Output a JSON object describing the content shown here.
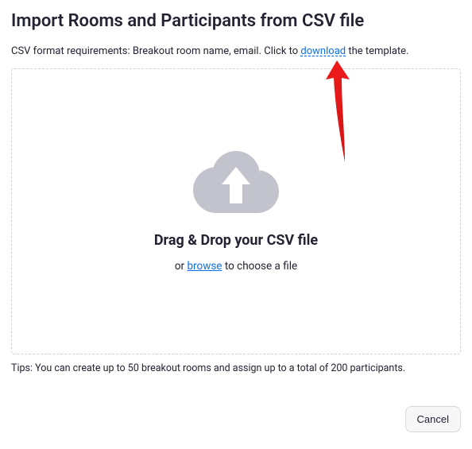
{
  "dialog": {
    "title": "Import Rooms and Participants from CSV file",
    "instructions_prefix": "CSV format requirements: Breakout room name, email. Click to ",
    "download_label": "download",
    "instructions_suffix": " the template.",
    "drop_title": "Drag & Drop your CSV file",
    "drop_sub_prefix": "or ",
    "browse_label": "browse",
    "drop_sub_suffix": " to choose a file",
    "tips": "Tips: You can create up to 50 breakout rooms and assign up to a total of 200 participants.",
    "cancel_label": "Cancel"
  },
  "colors": {
    "link": "#0E71EB",
    "icon_fill": "#C3C3CE",
    "arrow": "#EE1B1B"
  }
}
